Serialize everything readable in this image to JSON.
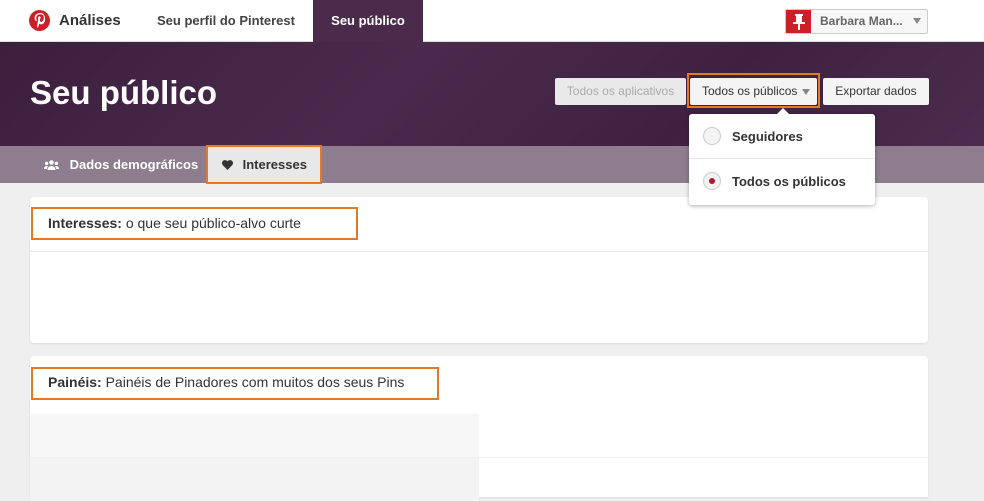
{
  "topnav": {
    "app_title": "Análises",
    "tabs": [
      {
        "label": "Seu perfil do Pinterest"
      },
      {
        "label": "Seu público"
      }
    ],
    "user_name": "Barbara Man..."
  },
  "header": {
    "title": "Seu público",
    "buttons": {
      "apps": "Todos os aplicativos",
      "audiences": "Todos os públicos",
      "export": "Exportar dados"
    }
  },
  "subnav": {
    "demographics": "Dados demográficos",
    "interests": "Interesses"
  },
  "dropdown": {
    "options": [
      {
        "label": "Seguidores",
        "selected": false
      },
      {
        "label": "Todos os públicos",
        "selected": true
      }
    ]
  },
  "cards": {
    "interests": {
      "title": "Interesses:",
      "subtitle": " o que seu público-alvo curte"
    },
    "boards": {
      "title": "Painéis:",
      "subtitle": " Painéis de Pinadores com muitos dos seus Pins"
    }
  },
  "colors": {
    "brand_red": "#cb2027",
    "header_purple": "#4a2b4c",
    "subnav_mauve": "#8d7d8e",
    "highlight_orange": "#e07a2a"
  }
}
